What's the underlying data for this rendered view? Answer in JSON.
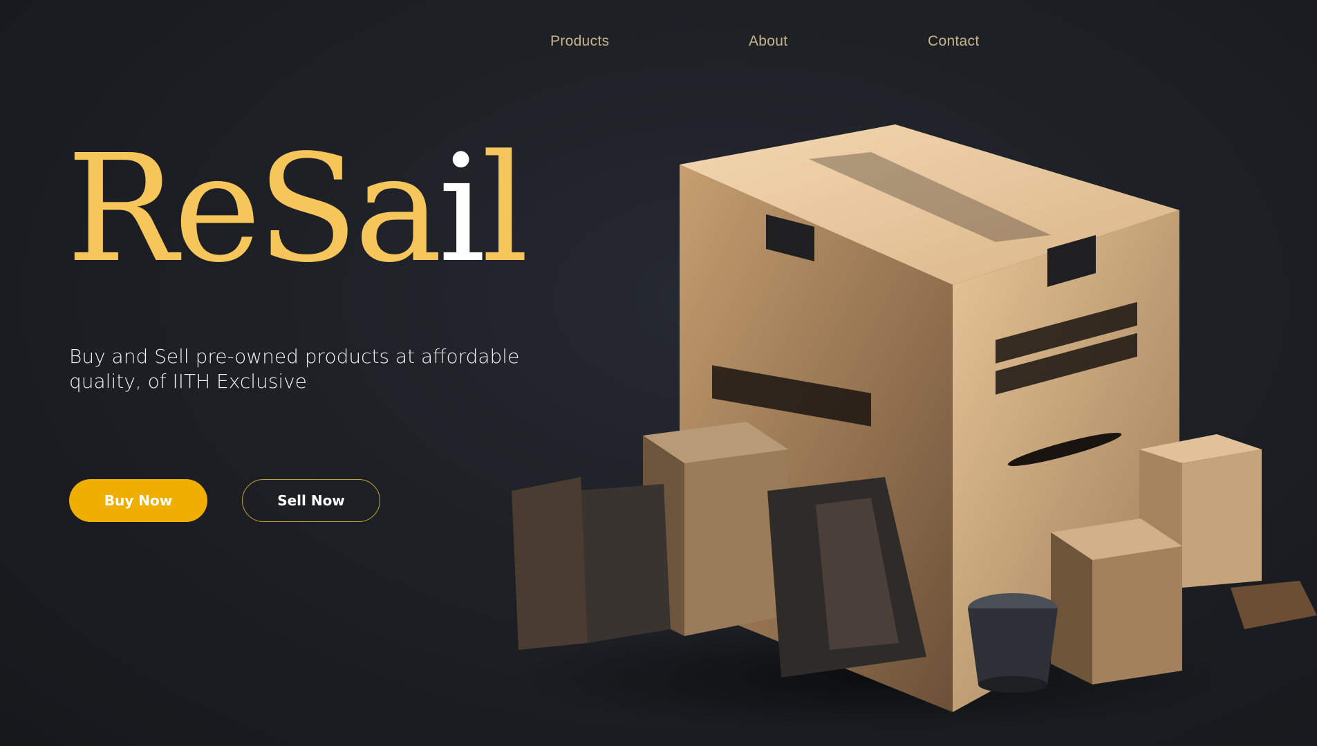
{
  "nav": {
    "items": [
      {
        "label": "Products"
      },
      {
        "label": "About"
      },
      {
        "label": "Contact"
      }
    ]
  },
  "hero": {
    "brand_main": "ReSa",
    "brand_accent": "i",
    "brand_tail": "l",
    "tagline": "Buy and Sell pre-owned products at affordable quality, of IITH Exclusive",
    "buy_label": "Buy Now",
    "sell_label": "Sell Now",
    "image_icon": "cardboard-box-illustration"
  },
  "colors": {
    "background": "#1d2025",
    "accent_gold": "#f6c65a",
    "button_gold": "#f0ae00",
    "nav_text": "#c9b48a",
    "text_white": "#ffffff"
  }
}
